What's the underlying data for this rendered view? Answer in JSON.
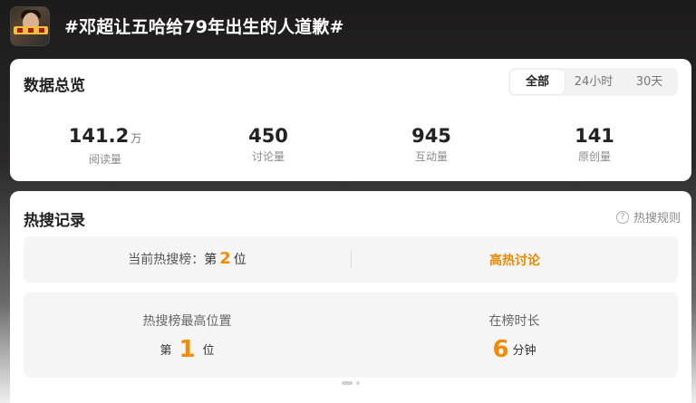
{
  "topic": {
    "title": "#邓超让五哈给79年出生的人道歉#",
    "thumbnail_icon": "topic-thumbnail"
  },
  "overview": {
    "title": "数据总览",
    "tabs": [
      {
        "label": "全部",
        "active": true
      },
      {
        "label": "24小时",
        "active": false
      },
      {
        "label": "30天",
        "active": false
      }
    ],
    "stats": [
      {
        "value": "141.2",
        "unit": "万",
        "label": "阅读量"
      },
      {
        "value": "450",
        "unit": "",
        "label": "讨论量"
      },
      {
        "value": "945",
        "unit": "",
        "label": "互动量"
      },
      {
        "value": "141",
        "unit": "",
        "label": "原创量"
      }
    ]
  },
  "hot": {
    "title": "热搜记录",
    "rules_label": "热搜规则",
    "rules_icon": "question-circle-icon",
    "current_prefix": "当前热搜榜：",
    "current_di": "第",
    "current_rank": "2",
    "current_wei": "位",
    "heat_label": "高热讨论",
    "highest_label": "热搜榜最高位置",
    "highest_di": "第",
    "highest_rank": "1",
    "highest_wei": "位",
    "duration_label": "在榜时长",
    "duration_value": "6",
    "duration_unit": "分钟"
  },
  "colors": {
    "accent": "#f28b00",
    "heat": "#e88a00"
  }
}
